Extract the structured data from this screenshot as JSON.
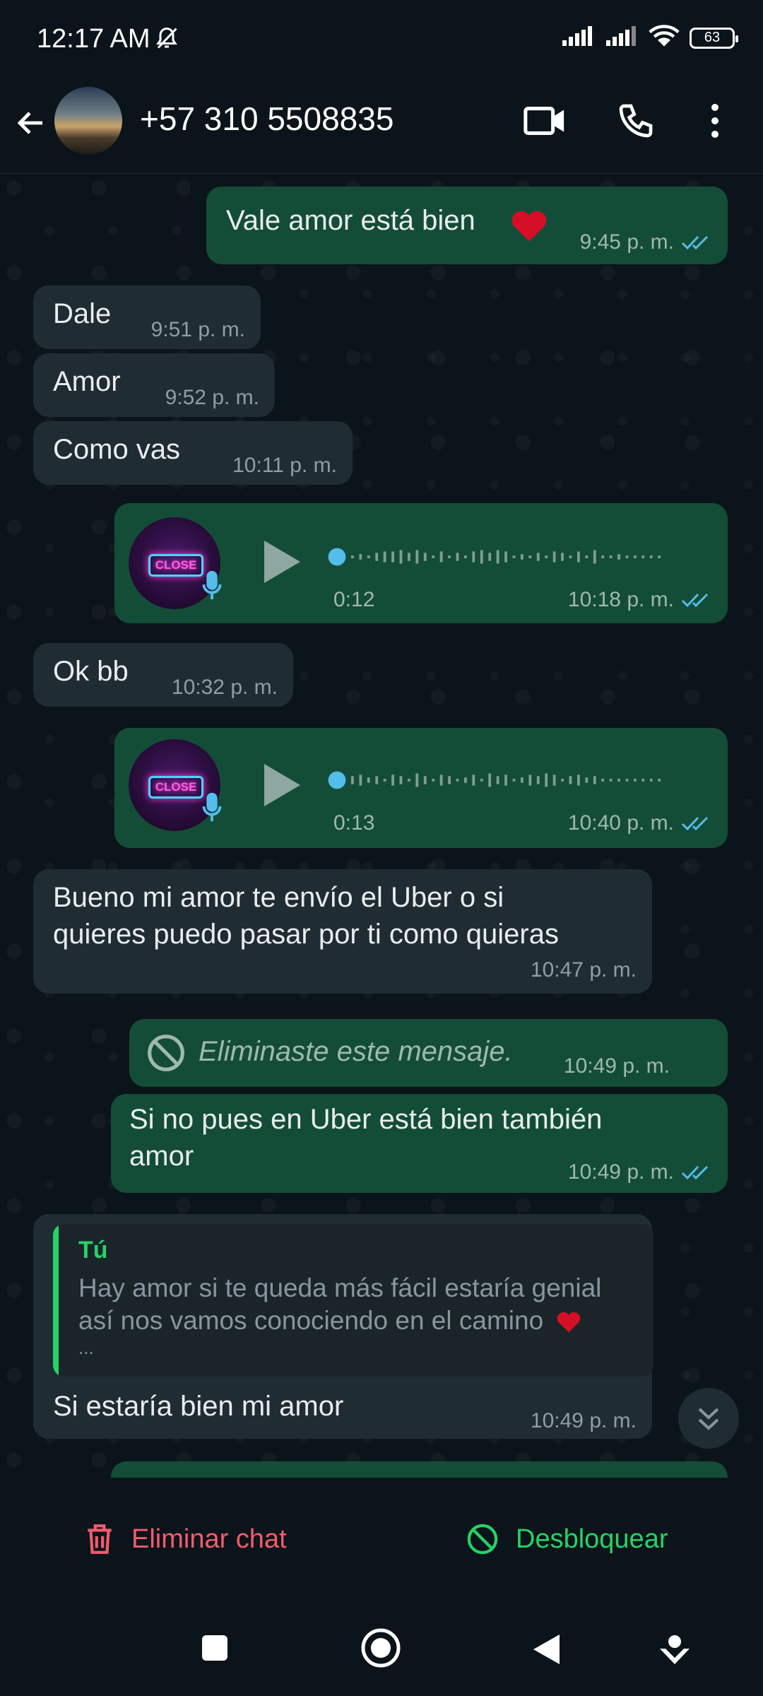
{
  "status_bar": {
    "time": "12:17 AM",
    "battery": "63"
  },
  "header": {
    "contact": "+57 310 5508835"
  },
  "messages": [
    {
      "dir": "out",
      "text": "Vale amor está bien",
      "time": "9:45 p. m."
    },
    {
      "dir": "in",
      "text": "Dale",
      "time": "9:51 p. m."
    },
    {
      "dir": "in",
      "text": "Amor",
      "time": "9:52 p. m."
    },
    {
      "dir": "in",
      "text": "Como vas",
      "time": "10:11 p. m."
    },
    {
      "dir": "out",
      "type": "voice",
      "duration": "0:12",
      "time": "10:18 p. m.",
      "avatar_text": "CLOSE"
    },
    {
      "dir": "in",
      "text": "Ok bb",
      "time": "10:32 p. m."
    },
    {
      "dir": "out",
      "type": "voice",
      "duration": "0:13",
      "time": "10:40 p. m.",
      "avatar_text": "CLOSE"
    },
    {
      "dir": "in",
      "line1": "Bueno mi amor te envío el Uber o si",
      "line2": "quieres puedo pasar por ti como quieras",
      "time": "10:47 p. m."
    },
    {
      "dir": "out",
      "type": "deleted",
      "text": "Eliminaste este mensaje.",
      "time": "10:49 p. m."
    },
    {
      "dir": "out",
      "line1": "Si no pues en Uber está bien también",
      "line2": "amor",
      "time": "10:49 p. m."
    },
    {
      "dir": "in",
      "quote_author": "Tú",
      "quote_line1": "Hay amor si te queda más fácil estaría genial",
      "quote_line2": "así nos vamos conociendo en el camino",
      "quote_line3": "...",
      "text": "Si estaría bien mi amor",
      "time": "10:49 p. m."
    }
  ],
  "actions": {
    "delete_chat": "Eliminar chat",
    "unblock": "Desbloquear"
  },
  "colors": {
    "outgoing": "#144d37",
    "incoming": "#202c33",
    "read_ticks": "#53bdeb",
    "danger": "#f15c6d",
    "accent": "#25d366"
  }
}
